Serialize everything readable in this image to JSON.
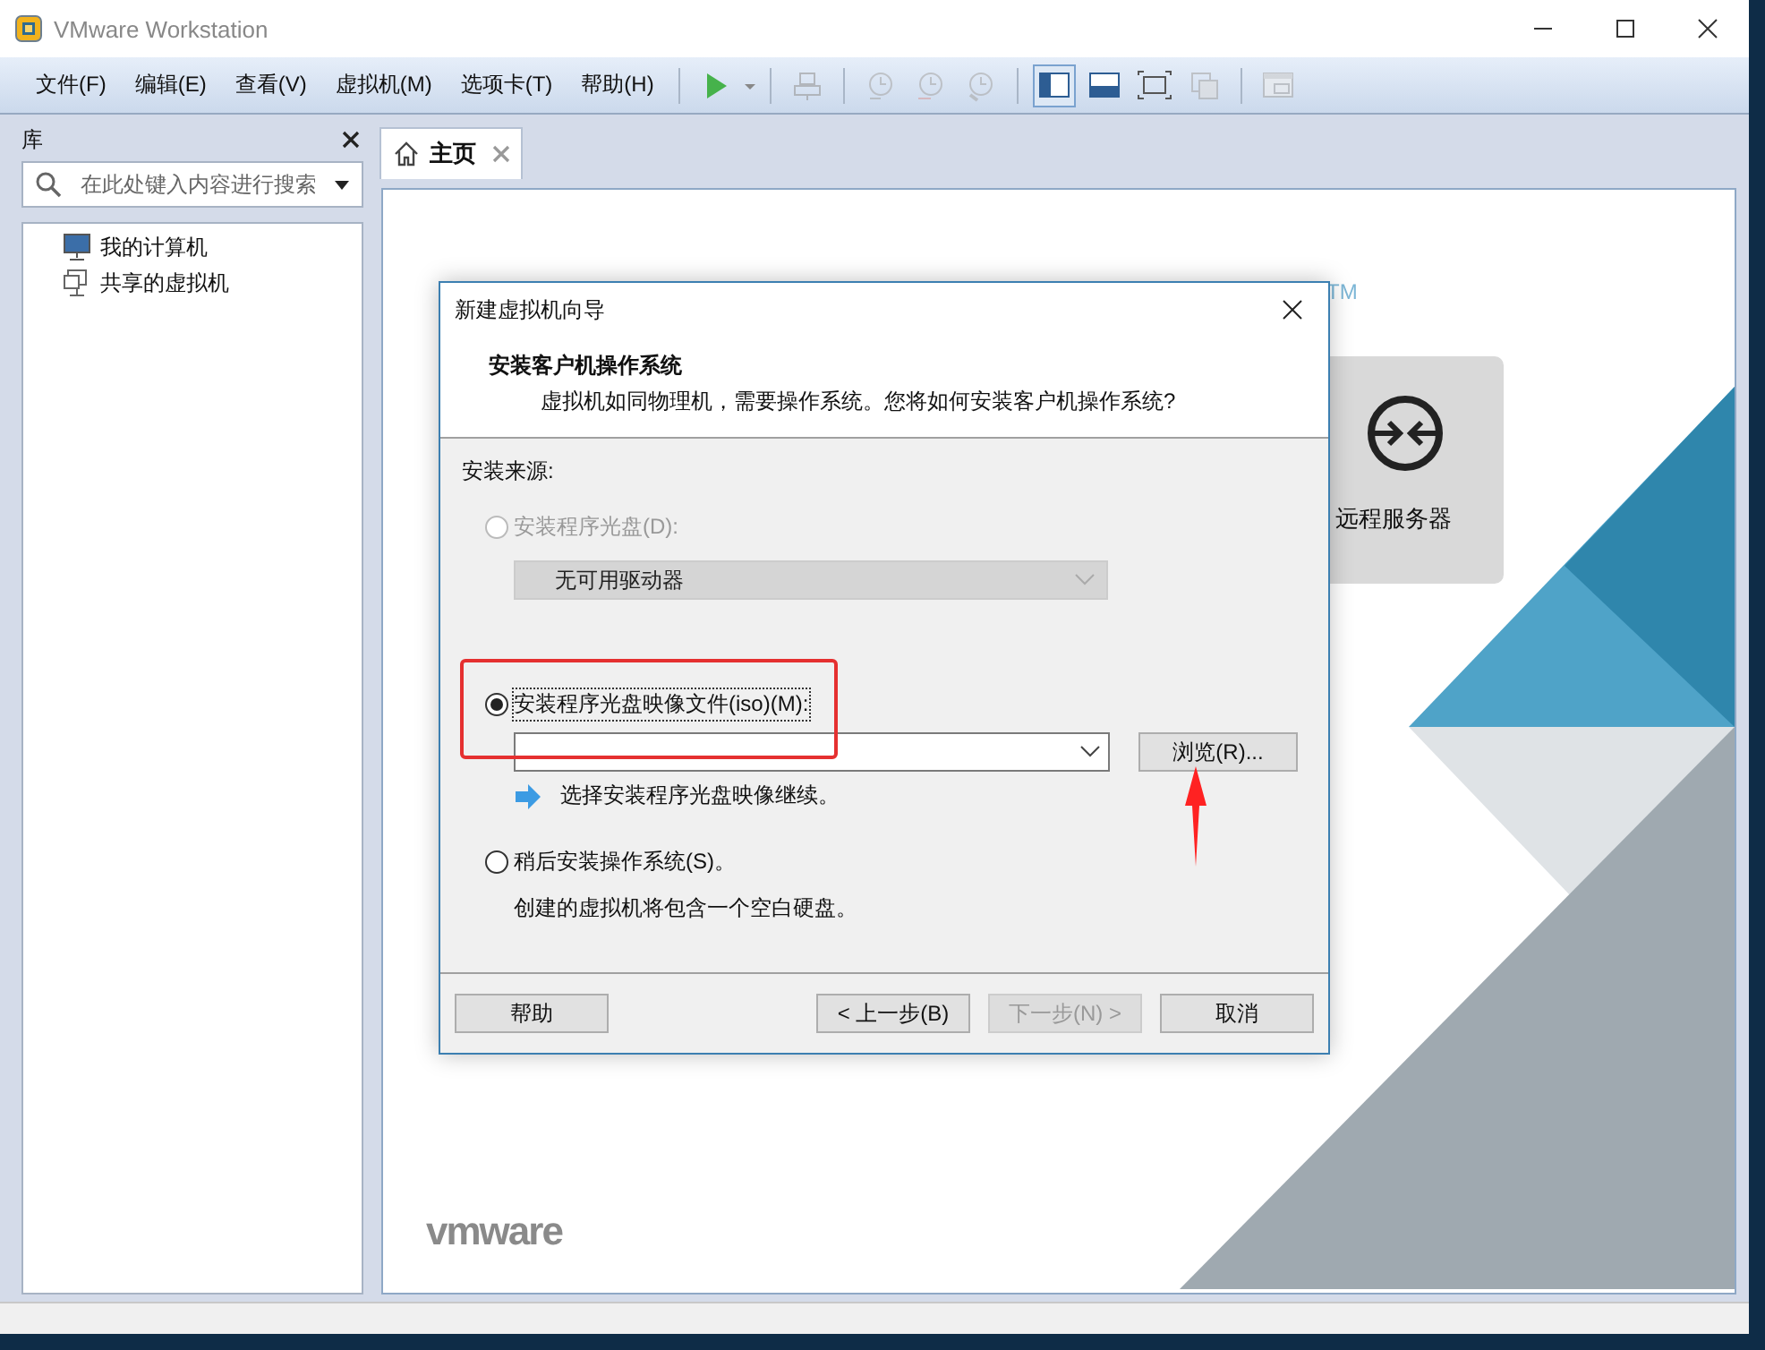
{
  "window": {
    "title": "VMware Workstation"
  },
  "menu": [
    {
      "label": "文件(F)"
    },
    {
      "label": "编辑(E)"
    },
    {
      "label": "查看(V)"
    },
    {
      "label": "虚拟机(M)"
    },
    {
      "label": "选项卡(T)"
    },
    {
      "label": "帮助(H)"
    }
  ],
  "toolbar": [
    {
      "kind": "play",
      "disabled": false,
      "selected": false
    },
    {
      "kind": "send",
      "disabled": true,
      "selected": false
    },
    {
      "kind": "snapshot",
      "disabled": true,
      "selected": false
    },
    {
      "kind": "revert",
      "disabled": true,
      "selected": false
    },
    {
      "kind": "manage",
      "disabled": true,
      "selected": false
    },
    {
      "kind": "sidebar",
      "disabled": false,
      "selected": true
    },
    {
      "kind": "thumbs",
      "disabled": false,
      "selected": false
    },
    {
      "kind": "fullscreen",
      "disabled": false,
      "selected": false
    },
    {
      "kind": "unity",
      "disabled": true,
      "selected": false
    },
    {
      "kind": "console",
      "disabled": true,
      "selected": false
    }
  ],
  "library": {
    "title": "库",
    "search": {
      "placeholder": "在此处键入内容进行搜索"
    },
    "items": [
      {
        "kind": "computer",
        "label": "我的计算机"
      },
      {
        "kind": "shared",
        "label": "共享的虚拟机"
      }
    ]
  },
  "tabs": [
    {
      "label": "主页",
      "selected": true
    }
  ],
  "home": {
    "trademark": "TM",
    "card": {
      "label": "远程服务器"
    },
    "logo": "vmware"
  },
  "dialog": {
    "title": "新建虚拟机向导",
    "heading": "安装客户机操作系统",
    "subheading": "虚拟机如同物理机，需要操作系统。您将如何安装客户机操作系统?",
    "source_label": "安装来源:",
    "options": [
      {
        "kind": "drive",
        "label": "安装程序光盘(D):",
        "selected": false,
        "disabled": true,
        "dropdown": "无可用驱动器"
      },
      {
        "kind": "image",
        "label": "安装程序光盘映像文件(iso)(M):",
        "selected": true,
        "disabled": false,
        "browse": "浏览(R)...",
        "hint": "选择安装程序光盘映像继续。"
      },
      {
        "kind": "later",
        "label": "稍后安装操作系统(S)。",
        "selected": false,
        "disabled": false,
        "note": "创建的虚拟机将包含一个空白硬盘。"
      }
    ],
    "buttons": [
      {
        "label": "帮助",
        "disabled": false
      },
      {
        "label": "< 上一步(B)",
        "disabled": false
      },
      {
        "label": "下一步(N) >",
        "disabled": true
      },
      {
        "label": "取消",
        "disabled": false
      }
    ]
  }
}
